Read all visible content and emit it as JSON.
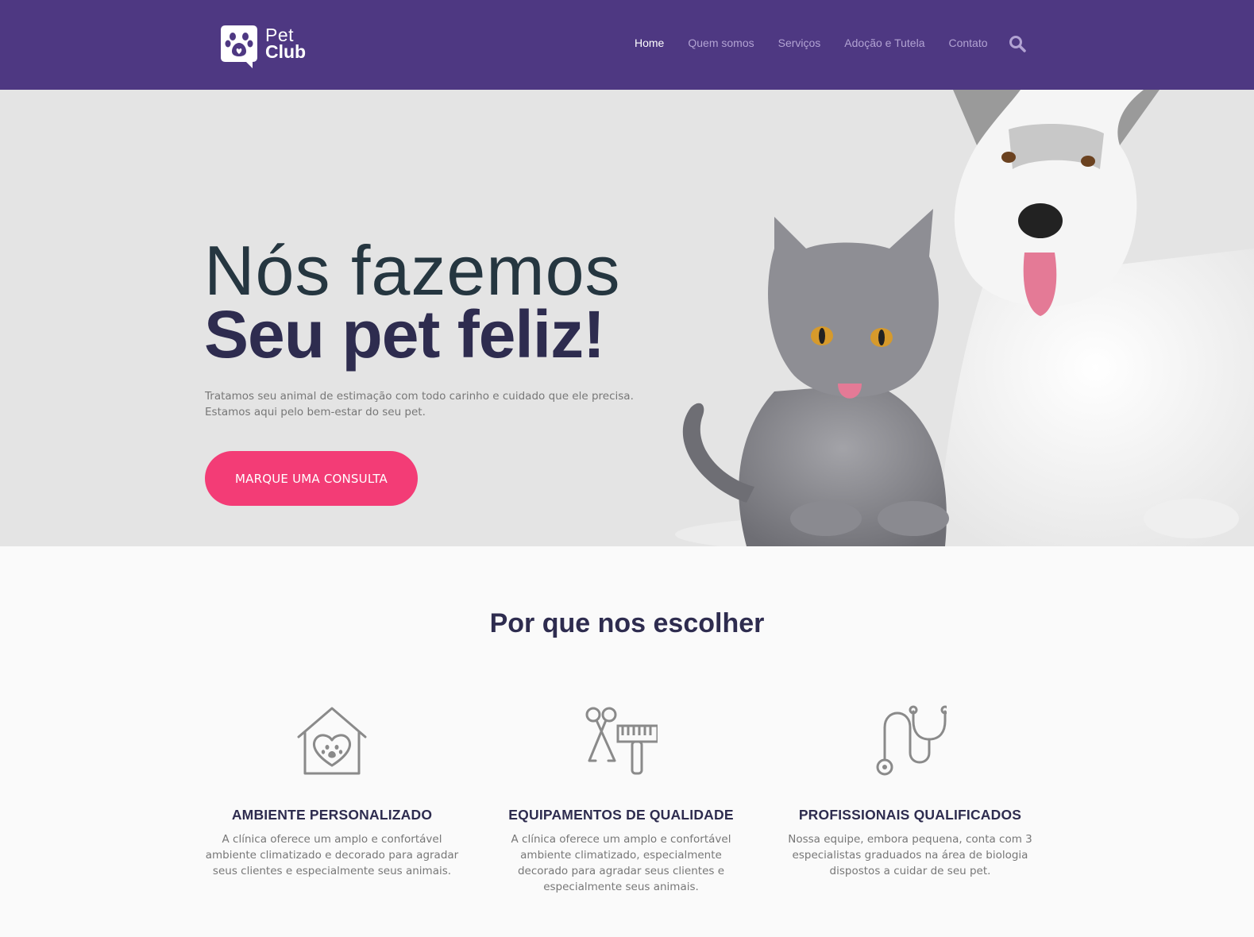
{
  "brand": {
    "name_line1": "Pet",
    "name_line2": "Club",
    "logo_icon": "paw-chat-bubble-icon",
    "colors": {
      "header": "#4e3882",
      "accent": "#f33c76",
      "heading": "#2e2c4f"
    }
  },
  "nav": {
    "items": [
      {
        "label": "Home",
        "active": true
      },
      {
        "label": "Quem somos",
        "active": false
      },
      {
        "label": "Serviços",
        "active": false
      },
      {
        "label": "Adoção e Tutela",
        "active": false
      },
      {
        "label": "Contato",
        "active": false
      }
    ],
    "search_icon": "search-icon"
  },
  "hero": {
    "title_line1": "Nós fazemos",
    "title_line2": "Seu pet feliz!",
    "description_line1": "Tratamos seu animal de estimação com todo carinho e cuidado que ele precisa.",
    "description_line2": "Estamos aqui pelo bem-estar do seu pet.",
    "cta_label": "MARQUE UMA CONSULTA"
  },
  "why": {
    "title": "Por que nos escolher",
    "features": [
      {
        "icon": "pet-house-icon",
        "title": "AMBIENTE PERSONALIZADO",
        "text": "A clínica oferece um amplo e confortável ambiente climatizado e decorado para agradar seus clientes e especialmente seus animais."
      },
      {
        "icon": "grooming-tools-icon",
        "title": "EQUIPAMENTOS DE QUALIDADE",
        "text": "A clínica oferece um amplo e confortável ambiente climatizado, especialmente decorado para agradar seus clientes e especialmente seus animais."
      },
      {
        "icon": "stethoscope-icon",
        "title": "PROFISSIONAIS QUALIFICADOS",
        "text": "Nossa equipe, embora pequena, conta com 3 especialistas graduados na área de biologia dispostos a cuidar de seu pet."
      }
    ]
  }
}
